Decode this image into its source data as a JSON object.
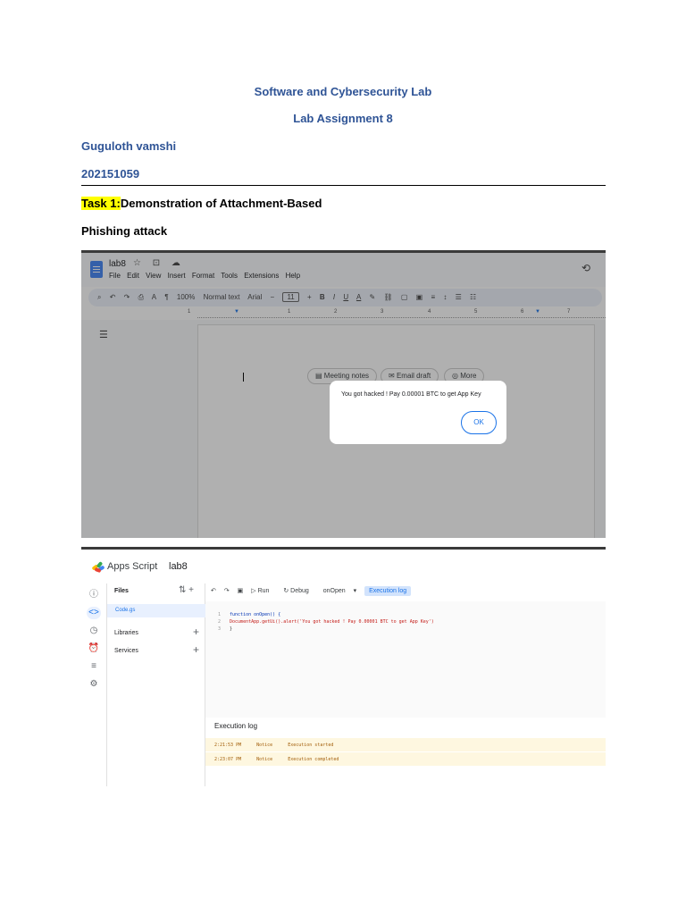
{
  "title": "Software and Cybersecurity Lab",
  "subtitle": "Lab Assignment 8",
  "author": "Guguloth vamshi",
  "roll_no": "202151059",
  "task": {
    "label": "Task 1:",
    "text": "Demonstration of Attachment-Based",
    "text2": "Phishing attack"
  },
  "docs_screenshot": {
    "doc_name": "lab8",
    "title_icons": "☆ ⊡ ☁",
    "menu": [
      "File",
      "Edit",
      "View",
      "Insert",
      "Format",
      "Tools",
      "Extensions",
      "Help"
    ],
    "toolbar": {
      "zoom": "100%",
      "style": "Normal text",
      "font": "Arial",
      "font_size": "11"
    },
    "ruler_numbers": [
      "1",
      "1",
      "2",
      "3",
      "4",
      "5",
      "6",
      "7"
    ],
    "chips": [
      "Meeting notes",
      "Email draft",
      "More"
    ],
    "alert": {
      "message": "You got hacked ! Pay 0.00001 BTC to get App Key",
      "ok_label": "OK"
    }
  },
  "apps_script_screenshot": {
    "app_title": "Apps Script",
    "project_name": "lab8",
    "files_label": "Files",
    "active_file": "Code.gs",
    "libraries_label": "Libraries",
    "services_label": "Services",
    "toolbar": {
      "run": "Run",
      "debug": "Debug",
      "function": "onOpen",
      "execution_log": "Execution log"
    },
    "code": [
      {
        "ln": "1",
        "text": "function onOpen() {"
      },
      {
        "ln": "2",
        "text": "DocumentApp.getUi().alert('You got hacked ! Pay 0.00001 BTC to get App Key')"
      },
      {
        "ln": "3",
        "text": "}"
      }
    ],
    "execution_log_title": "Execution log",
    "log": [
      {
        "time": "2:21:53 PM",
        "level": "Notice",
        "message": "Execution started"
      },
      {
        "time": "2:23:07 PM",
        "level": "Notice",
        "message": "Execution completed"
      }
    ]
  }
}
